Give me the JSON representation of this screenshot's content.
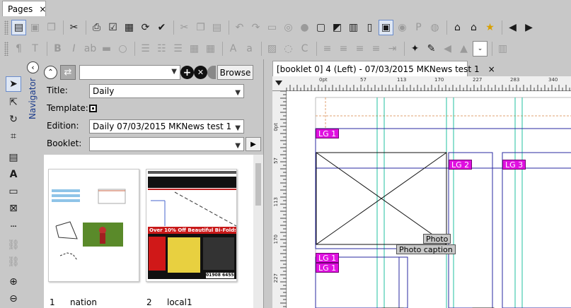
{
  "top_tab": {
    "label": "Pages",
    "close": "×"
  },
  "navigator": {
    "label": "Navigator",
    "collapse_glyph": "‹"
  },
  "panel": {
    "browse_label": "Browse",
    "title_label": "Title:",
    "title_value": "Daily",
    "template_label": "Template:",
    "edition_label": "Edition:",
    "edition_value": "Daily 07/03/2015 MKNews test 1",
    "booklet_label": "Booklet:",
    "booklet_value": "",
    "thumbnails": [
      {
        "number": "1",
        "name": "nation"
      },
      {
        "number": "2",
        "name": "local1"
      }
    ],
    "ad_headline": "Over 10% Off Beautiful Bi-Folds",
    "ad_phone": "01908 645566"
  },
  "editor": {
    "tab_label": "[booklet 0] 4 (Left) - 07/03/2015 MKNews test 1",
    "tab_close": "×",
    "ruler_h_ticks": [
      "0pt",
      "57",
      "113",
      "170",
      "227",
      "283",
      "340"
    ],
    "ruler_v_ticks": [
      "0pt",
      "57",
      "113",
      "170",
      "227"
    ],
    "layout_groups": [
      "LG 1",
      "LG 2",
      "LG 3",
      "LG 1",
      "LG 1"
    ],
    "photo_label": "Photo",
    "caption_label": "Photo caption"
  },
  "colors": {
    "lg_magenta": "#e010e0",
    "guide_cyan": "#20c0a0",
    "frame_blue": "#2a2aa0"
  }
}
